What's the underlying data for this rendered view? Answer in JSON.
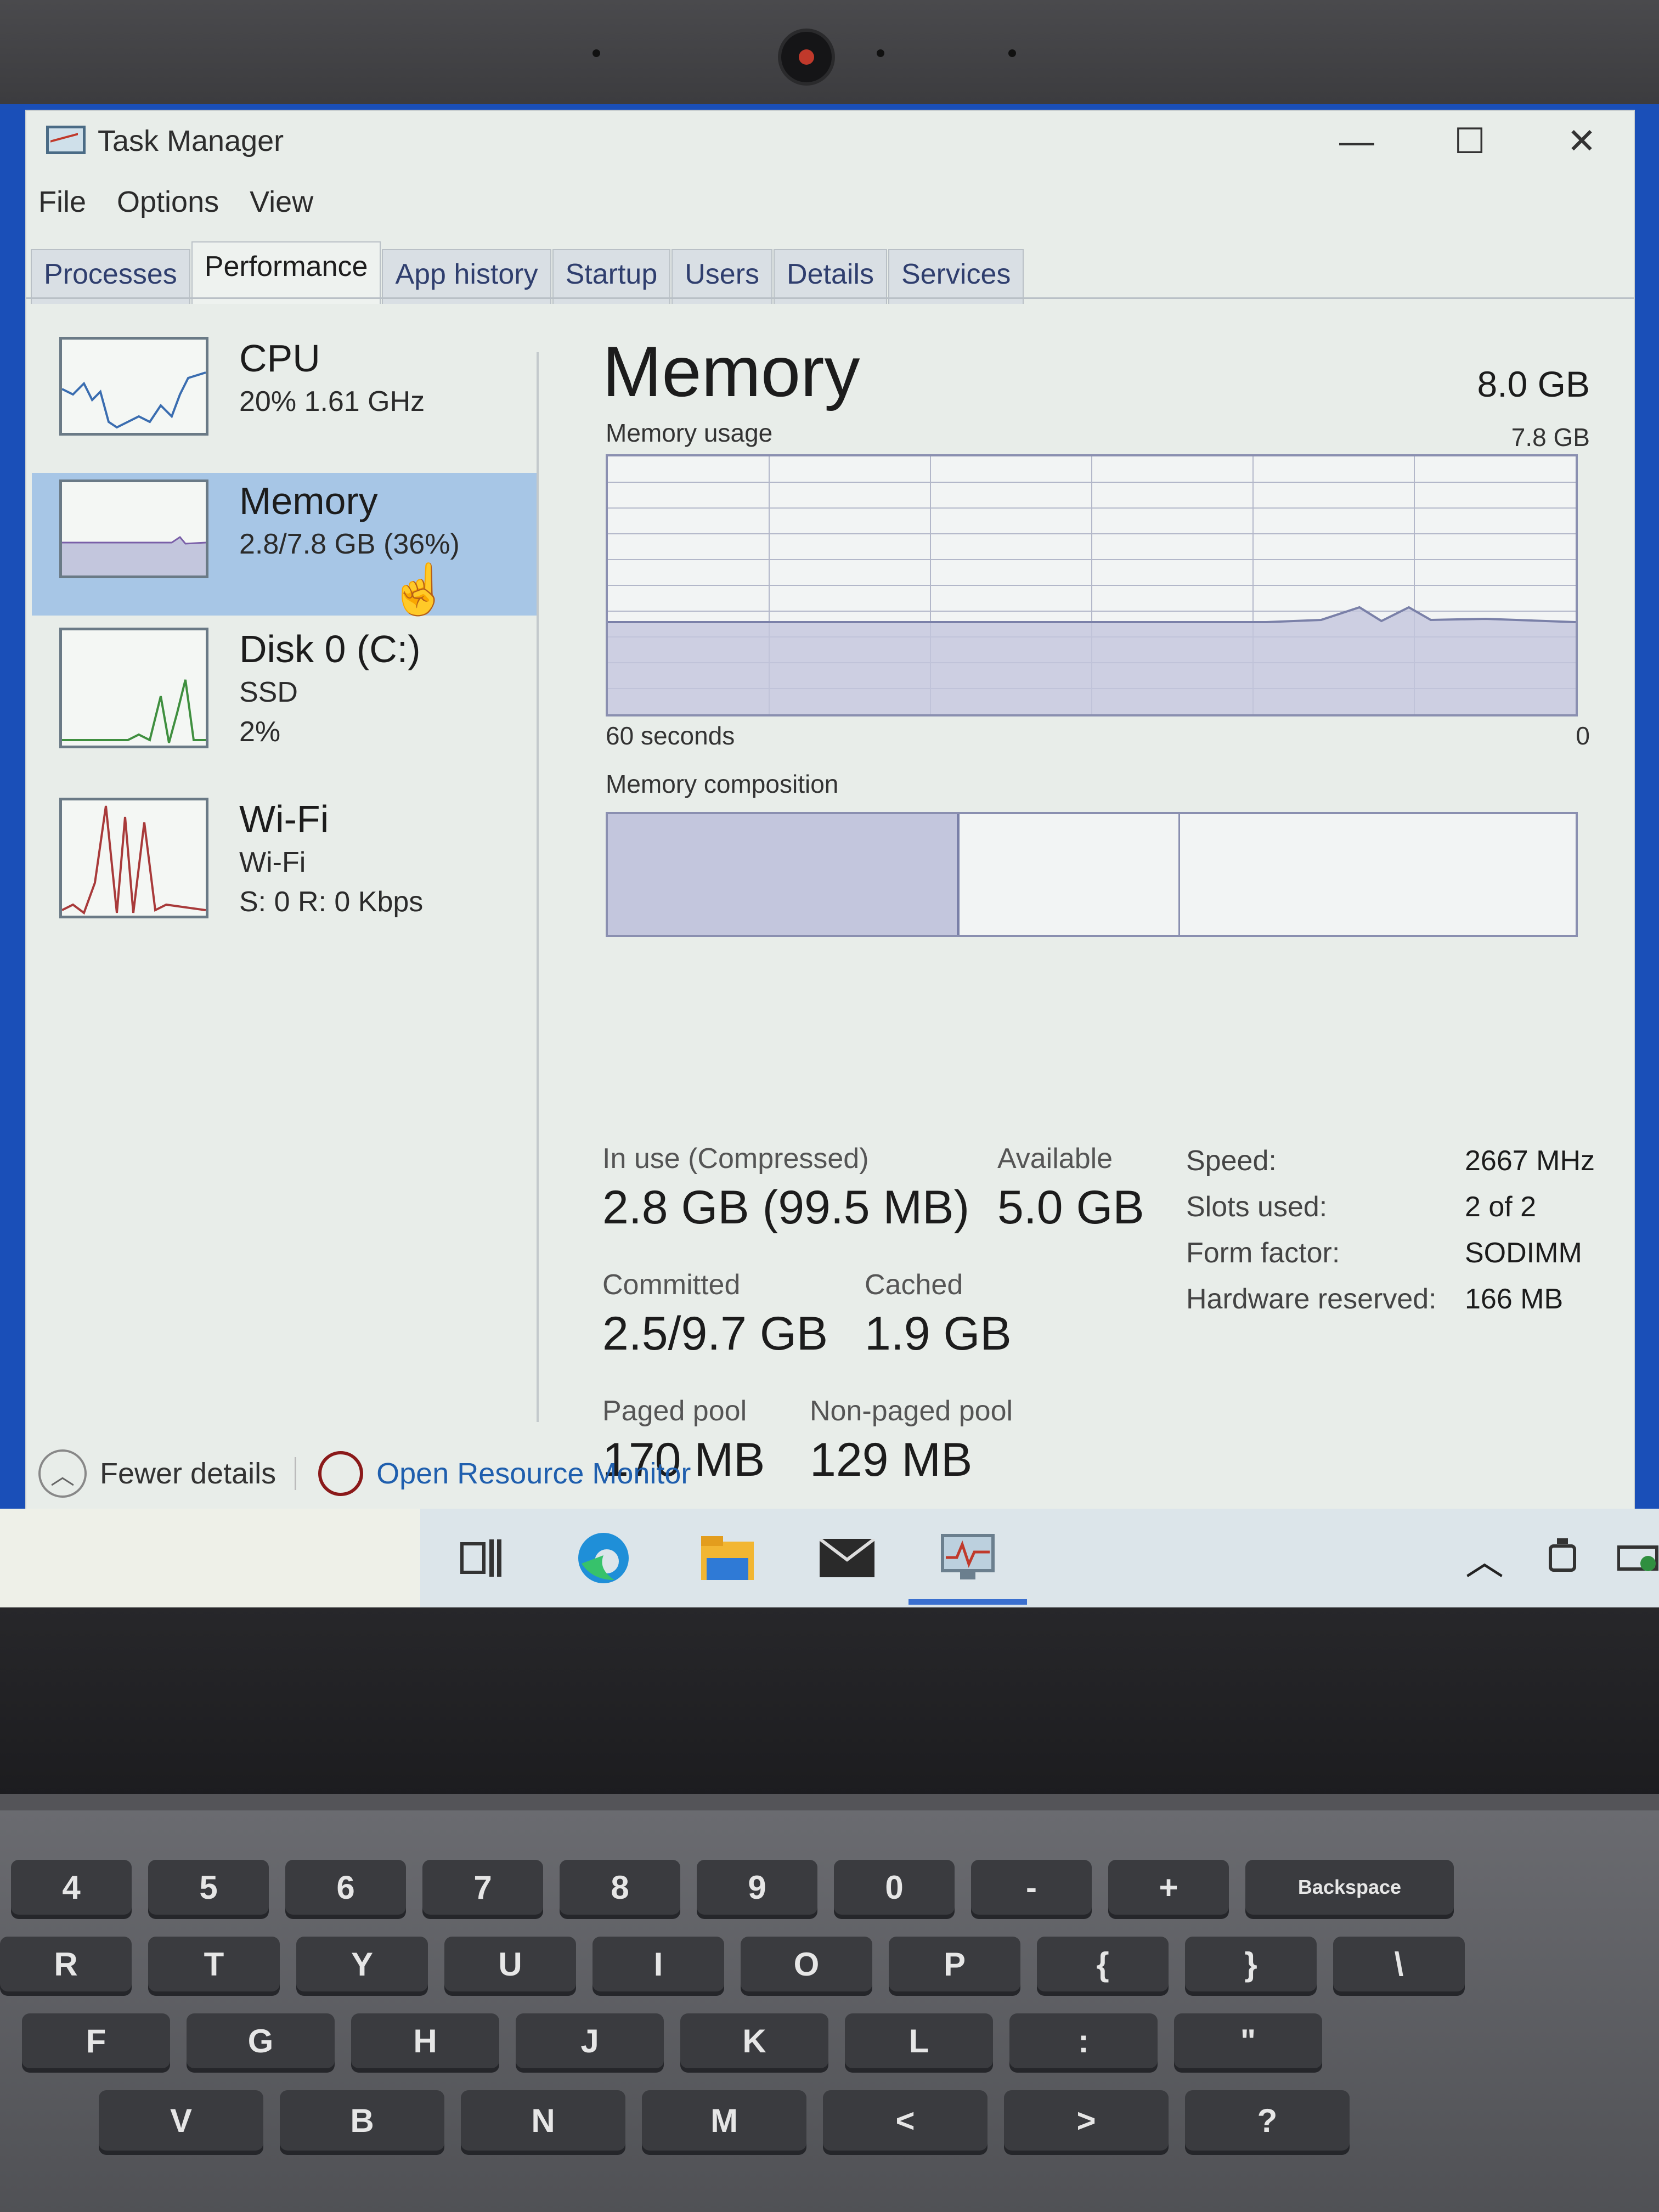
{
  "window": {
    "title": "Task Manager",
    "controls": {
      "minimize": "—",
      "maximize": "☐",
      "close": "✕"
    }
  },
  "menu": [
    "File",
    "Options",
    "View"
  ],
  "tabs": [
    "Processes",
    "Performance",
    "App history",
    "Startup",
    "Users",
    "Details",
    "Services"
  ],
  "active_tab": "Performance",
  "sidebar": [
    {
      "name": "CPU",
      "line1": "20%  1.61 GHz",
      "line2": "",
      "color": "#3a6db0"
    },
    {
      "name": "Memory",
      "line1": "2.8/7.8 GB (36%)",
      "line2": "",
      "color": "#7a5fa8",
      "selected": true,
      "level": 0.36
    },
    {
      "name": "Disk 0 (C:)",
      "line1": "SSD",
      "line2": "2%",
      "color": "#3f8f3f"
    },
    {
      "name": "Wi-Fi",
      "line1": "Wi-Fi",
      "line2": "S: 0 R: 0 Kbps",
      "color": "#a83a3a"
    }
  ],
  "memory": {
    "title": "Memory",
    "total": "8.0 GB",
    "usage_label": "Memory usage",
    "usage_max": "7.8 GB",
    "time_left": "60 seconds",
    "time_right": "0",
    "composition_label": "Memory composition",
    "stats": {
      "in_use_label": "In use (Compressed)",
      "in_use_value": "2.8 GB (99.5 MB)",
      "available_label": "Available",
      "available_value": "5.0 GB",
      "committed_label": "Committed",
      "committed_value": "2.5/9.7 GB",
      "cached_label": "Cached",
      "cached_value": "1.9 GB",
      "paged_label": "Paged pool",
      "paged_value": "170 MB",
      "nonpaged_label": "Non-paged pool",
      "nonpaged_value": "129 MB"
    },
    "details": [
      {
        "key": "Speed:",
        "value": "2667 MHz"
      },
      {
        "key": "Slots used:",
        "value": "2 of 2"
      },
      {
        "key": "Form factor:",
        "value": "SODIMM"
      },
      {
        "key": "Hardware reserved:",
        "value": "166 MB"
      }
    ],
    "graph_accent": "#8a8fb0",
    "graph_fill": "#c3c6dd"
  },
  "footer": {
    "fewer_details": "Fewer details",
    "open_resource_monitor": "Open Resource Monitor"
  },
  "taskbar_icons": [
    "task-view-icon",
    "edge-icon",
    "file-explorer-icon",
    "mail-icon",
    "task-manager-icon",
    "chevron-up-icon",
    "meet-now-icon",
    "battery-icon"
  ],
  "keyboard": {
    "row1": [
      "4",
      "5",
      "6",
      "7",
      "8",
      "9",
      "0",
      "-",
      "+",
      "Backspace"
    ],
    "row2": [
      "R",
      "T",
      "Y",
      "U",
      "I",
      "O",
      "P",
      "{",
      "}",
      "\\"
    ],
    "row3": [
      "F",
      "G",
      "H",
      "J",
      "K",
      "L",
      ":",
      "\""
    ],
    "row4": [
      "V",
      "B",
      "N",
      "M",
      "<",
      ">",
      "?"
    ]
  }
}
